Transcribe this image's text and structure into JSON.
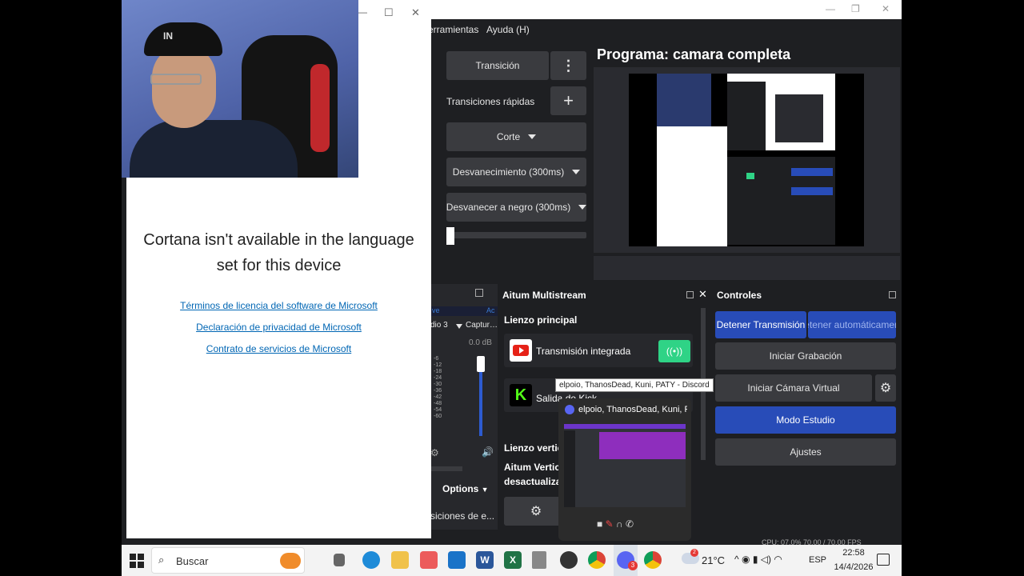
{
  "obs": {
    "menu": {
      "tools": "erramientas",
      "help": "Ayuda (H)"
    },
    "window_controls": {
      "minimize": "—",
      "maximize": "❐",
      "close": "✕"
    },
    "program_title": "Programa: camara completa",
    "transitions": {
      "transition_button": "Transición",
      "quick_transitions_label": "Transiciones rápidas",
      "cut": "Corte",
      "fade": "Desvanecimiento (300ms)",
      "fade_black": "Desvanecer a negro (300ms)"
    },
    "audio": {
      "tabs": [
        "ve",
        "Ac"
      ],
      "source": "dio 3",
      "capture": "Captur…",
      "db": "0.0 dB",
      "scale": [
        "-6",
        "-12",
        "-18",
        "-24",
        "-30",
        "-36",
        "-42",
        "-48",
        "-54",
        "-60"
      ]
    },
    "scene_transitions": {
      "options": "Options",
      "label": "siciones de e..."
    },
    "multistream": {
      "title": "Aitum Multistream",
      "main_canvas": "Lienzo principal",
      "integrated": "Transmisión integrada",
      "kick": "Salida de Kick",
      "vertical_canvas": "Lienzo vertica",
      "vertical_note_1": "Aitum Vertical",
      "vertical_note_2": "desactualizado"
    },
    "controls": {
      "title": "Controles",
      "stop_stream": "Detener Transmisión",
      "stop_auto": "etener automáticamen",
      "start_recording": "Iniciar Grabación",
      "virtual_cam": "Iniciar Cámara Virtual",
      "studio_mode": "Modo Estudio",
      "settings": "Ajustes"
    },
    "status_bar": "CPU: 07.0%   70.00 / 70.00 FPS"
  },
  "discord_tooltip": "elpoio, ThanosDead, Kuni, PATY - Discord",
  "discord_preview_title": "elpoio, ThanosDead, Kuni, PATY...",
  "cortana": {
    "window_controls": {
      "minimize": "—",
      "maximize": "☐",
      "close": "✕"
    },
    "message": "Cortana isn't available in the language set for this device",
    "links": [
      "Términos de licencia del software de Microsoft",
      "Declaración de privacidad de Microsoft",
      "Contrato de servicios de Microsoft"
    ]
  },
  "taskbar": {
    "search_placeholder": "Buscar",
    "weather_temp": "21°C",
    "weather_badge": "2",
    "language": "ESP",
    "time": "22:58",
    "date": "14/4/2026",
    "discord_badge": "3"
  },
  "colors": {
    "obs_bg": "#1e1f22",
    "accent_blue": "#284cb8",
    "green": "#2fd386",
    "link": "#0066b4"
  }
}
